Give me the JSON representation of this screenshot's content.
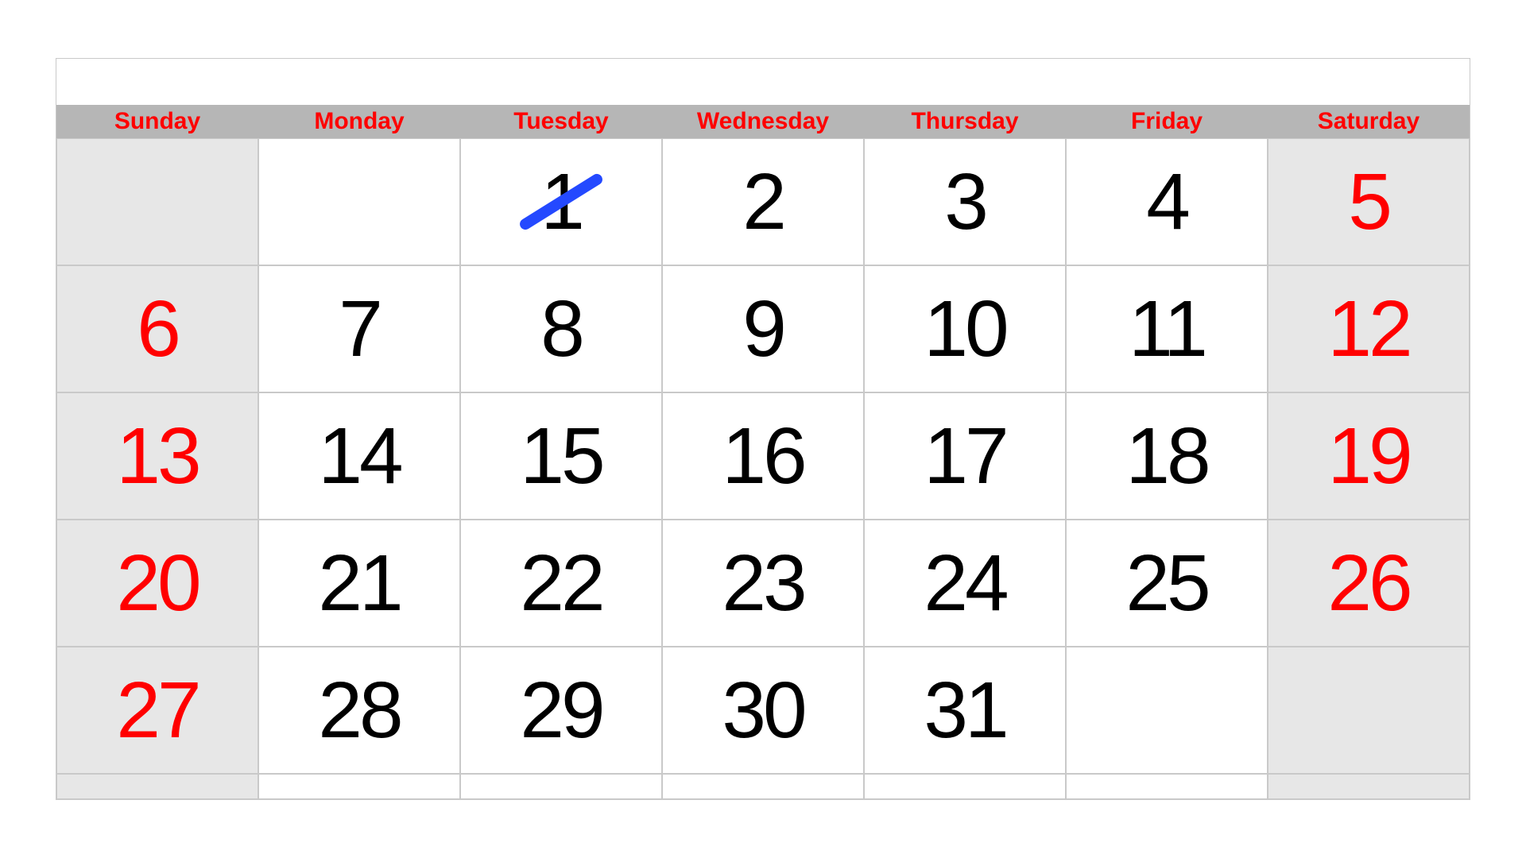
{
  "headers": [
    "Sunday",
    "Monday",
    "Tuesday",
    "Wednesday",
    "Thursday",
    "Friday",
    "Saturday"
  ],
  "weekendIndexes": [
    0,
    6
  ],
  "crossedOut": [
    1
  ],
  "colors": {
    "header_text": "#ff0000",
    "weekend_text": "#ff0000",
    "weekday_text": "#000000",
    "weekend_bg": "#e7e7e7",
    "border": "#c9c9c9",
    "header_bg": "#b6b6b6",
    "slash": "#2449ff"
  },
  "weeks": [
    [
      null,
      null,
      1,
      2,
      3,
      4,
      5
    ],
    [
      6,
      7,
      8,
      9,
      10,
      11,
      12
    ],
    [
      13,
      14,
      15,
      16,
      17,
      18,
      19
    ],
    [
      20,
      21,
      22,
      23,
      24,
      25,
      26
    ],
    [
      27,
      28,
      29,
      30,
      31,
      null,
      null
    ]
  ]
}
